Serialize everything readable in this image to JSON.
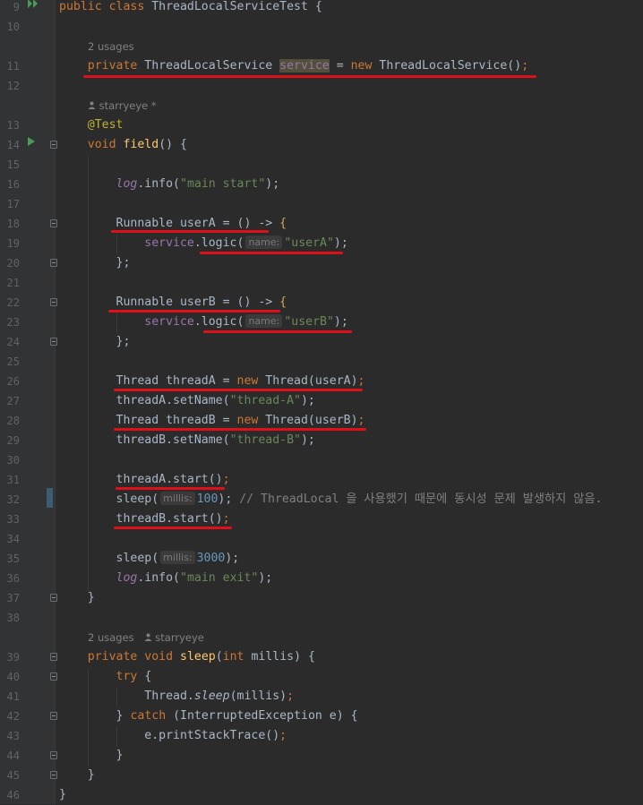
{
  "editor": {
    "class_decl": {
      "kw": "public class",
      "name": "ThreadLocalServiceTest",
      "brace": "{"
    },
    "hints": {
      "usages1": "2 usages",
      "author1": "starryeye *",
      "usages2": "2 usages",
      "author2": "starryeye"
    },
    "icons": {
      "run_class": "double-run-icon",
      "run_method": "run-icon",
      "author": "person-icon"
    },
    "line_numbers": [
      "9",
      "10",
      "11",
      "12",
      "13",
      "14",
      "15",
      "16",
      "17",
      "18",
      "19",
      "20",
      "21",
      "22",
      "23",
      "24",
      "25",
      "26",
      "27",
      "28",
      "29",
      "30",
      "31",
      "32",
      "33",
      "34",
      "35",
      "36",
      "37",
      "38",
      "39",
      "40",
      "41",
      "42",
      "43",
      "44",
      "45",
      "46"
    ],
    "lines": {
      "l11": {
        "kw": "private",
        "type": "ThreadLocalService",
        "field": "service",
        "eq": "=",
        "kw_new": "new",
        "rest": "ThreadLocalService()",
        "semi": ";"
      },
      "l13": {
        "ann": "@Test"
      },
      "l14": {
        "kw": "void",
        "fn": "field",
        "rest": "() {"
      },
      "l16": {
        "log": "log",
        "call": ".info(",
        "str": "\"main start\"",
        "end": ");"
      },
      "l18": {
        "text": "Runnable userA = () -> ",
        "brace": "{"
      },
      "l19": {
        "field": "service",
        "call": ".logic(",
        "param": "name:",
        "str": "\"userA\"",
        "end": ");"
      },
      "l20": {
        "text": "};"
      },
      "l22": {
        "text": "Runnable userB = () -> ",
        "brace": "{"
      },
      "l23": {
        "field": "service",
        "call": ".logic(",
        "param": "name:",
        "str": "\"userB\"",
        "end": ");"
      },
      "l24": {
        "text": "};"
      },
      "l26": {
        "pre": "Thread threadA = ",
        "kw": "new",
        "post": "Thread(userA)",
        "semi": ";"
      },
      "l27": {
        "call": "threadA.setName(",
        "str": "\"thread-A\"",
        "end": ");"
      },
      "l28": {
        "pre": "Thread threadB = ",
        "kw": "new",
        "post": "Thread(userB)",
        "semi": ";"
      },
      "l29": {
        "call": "threadB.setName(",
        "str": "\"thread-B\"",
        "end": ");"
      },
      "l31": {
        "call": "threadA.start()",
        "semi": ";"
      },
      "l32": {
        "call": "sleep(",
        "param": "millis:",
        "num": "100",
        "end": ");",
        "comment": "// ThreadLocal 을 사용했기 때문에 동시성 문제 발생하지 않음."
      },
      "l33": {
        "call": "threadB.start()",
        "semi": ";"
      },
      "l35": {
        "call": "sleep(",
        "param": "millis:",
        "num": "3000",
        "end": ");"
      },
      "l36": {
        "log": "log",
        "call": ".info(",
        "str": "\"main exit\"",
        "end": ");"
      },
      "l37": {
        "text": "}"
      },
      "l39": {
        "kw": "private void",
        "fn": "sleep",
        "paren": "(",
        "kw_int": "int",
        "rest": "millis) {"
      },
      "l40": {
        "kw": "try",
        "rest": "{"
      },
      "l41": {
        "call": "Thread.",
        "fn": "sleep",
        "rest": "(millis)",
        "semi": ";"
      },
      "l42": {
        "pre": "}",
        "kw": "catch",
        "rest": "(InterruptedException e) {"
      },
      "l43": {
        "call": "e.printStackTrace()",
        "semi": ";"
      },
      "l44": {
        "text": "}"
      },
      "l45": {
        "text": "}"
      },
      "l46": {
        "text": "}"
      }
    },
    "colors": {
      "background": "#2b2b2b",
      "gutter": "#313335",
      "keyword": "#cc7832",
      "function": "#ffc66d",
      "string": "#6a8759",
      "number": "#6897bb",
      "annotation": "#bbb529",
      "field": "#9876aa",
      "comment": "#808080",
      "text": "#a9b7c6",
      "underline": "#e0101a"
    }
  }
}
